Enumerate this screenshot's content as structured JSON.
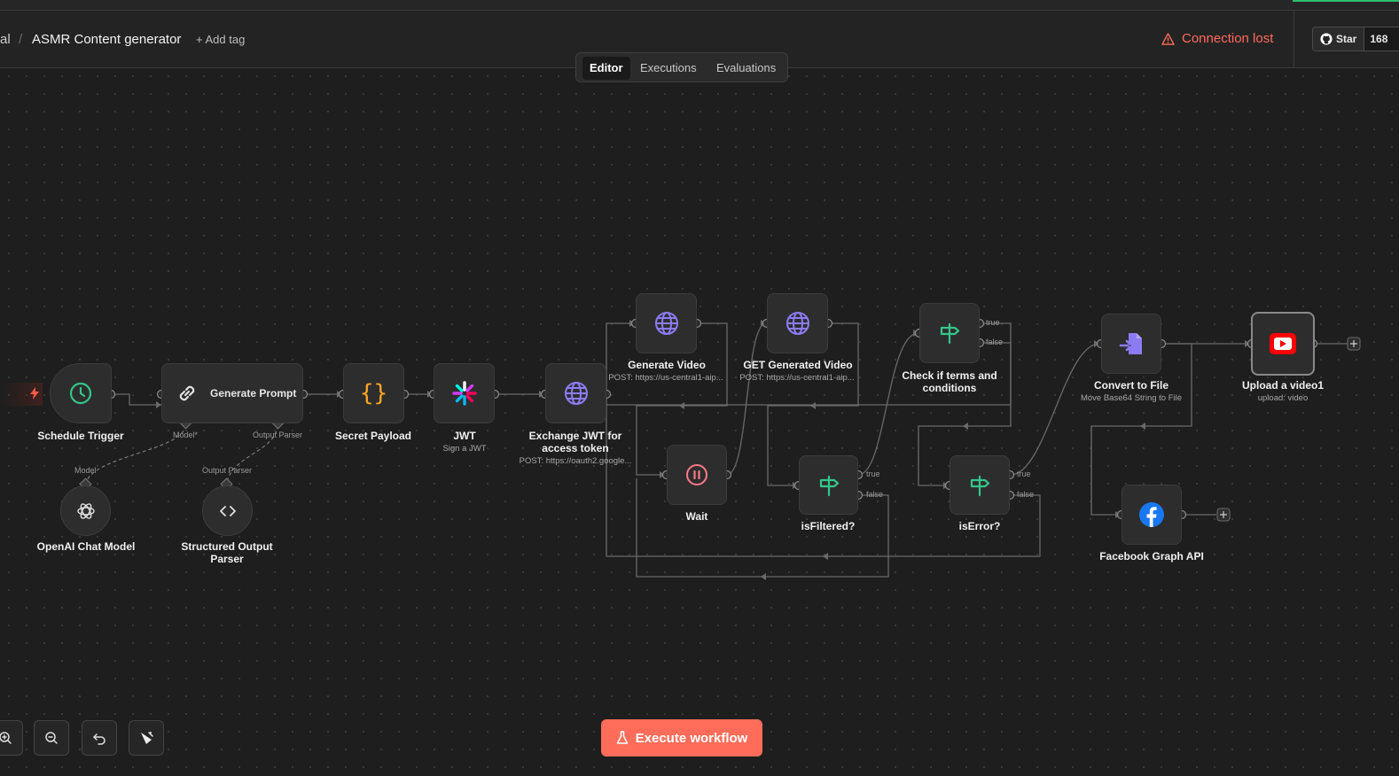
{
  "header": {
    "breadcrumb_prev": "al",
    "separator": "/",
    "workflow_name": "ASMR Content generator",
    "add_tag": "+ Add tag",
    "connection_status": "Connection lost",
    "github_star": "Star",
    "github_count": "168"
  },
  "tabs": [
    {
      "label": "Editor",
      "active": true
    },
    {
      "label": "Executions",
      "active": false
    },
    {
      "label": "Evaluations",
      "active": false
    }
  ],
  "nodes": {
    "schedule_trigger": {
      "label": "Schedule Trigger",
      "icon": "clock-icon"
    },
    "generate_prompt": {
      "label": "Generate Prompt",
      "icon": "link-icon",
      "port_model": "Model*",
      "port_parser": "Output Parser"
    },
    "openai_model": {
      "label": "OpenAI Chat Model",
      "port": "Model",
      "icon": "openai-icon"
    },
    "output_parser": {
      "label": "Structured Output Parser",
      "port": "Output Parser",
      "icon": "code-icon"
    },
    "secret_payload": {
      "label": "Secret Payload",
      "icon": "braces-icon"
    },
    "jwt": {
      "label": "JWT",
      "sub": "Sign a JWT",
      "icon": "jwt-icon"
    },
    "exchange_jwt": {
      "label": "Exchange JWT for access token",
      "sub": "POST: https://oauth2.google...",
      "icon": "globe-icon"
    },
    "generate_video": {
      "label": "Generate Video",
      "sub": "POST: https://us-central1-aip...",
      "icon": "globe-icon"
    },
    "get_generated_video": {
      "label": "GET Generated Video",
      "sub": "POST: https://us-central1-aip...",
      "icon": "globe-icon"
    },
    "wait": {
      "label": "Wait",
      "icon": "pause-icon"
    },
    "check_terms": {
      "label": "Check if terms and conditions",
      "true": "true",
      "false": "false",
      "icon": "signpost-icon"
    },
    "is_filtered": {
      "label": "isFiltered?",
      "true": "true",
      "false": "false",
      "icon": "signpost-icon"
    },
    "is_error": {
      "label": "isError?",
      "true": "true",
      "false": "false",
      "icon": "signpost-icon"
    },
    "convert_to_file": {
      "label": "Convert to File",
      "sub": "Move Base64 String to File",
      "icon": "file-convert-icon"
    },
    "upload_video": {
      "label": "Upload a video1",
      "sub": "upload: video",
      "icon": "youtube-icon"
    },
    "facebook_graph": {
      "label": "Facebook Graph API",
      "icon": "facebook-icon"
    }
  },
  "execute_button": "Execute workflow",
  "colors": {
    "accent": "#ff6d5a",
    "globe": "#8b7cf6",
    "clock": "#35c68a",
    "braces": "#f5a623",
    "signpost": "#35c68a",
    "youtube": "#ff0000",
    "facebook": "#1877f2"
  }
}
